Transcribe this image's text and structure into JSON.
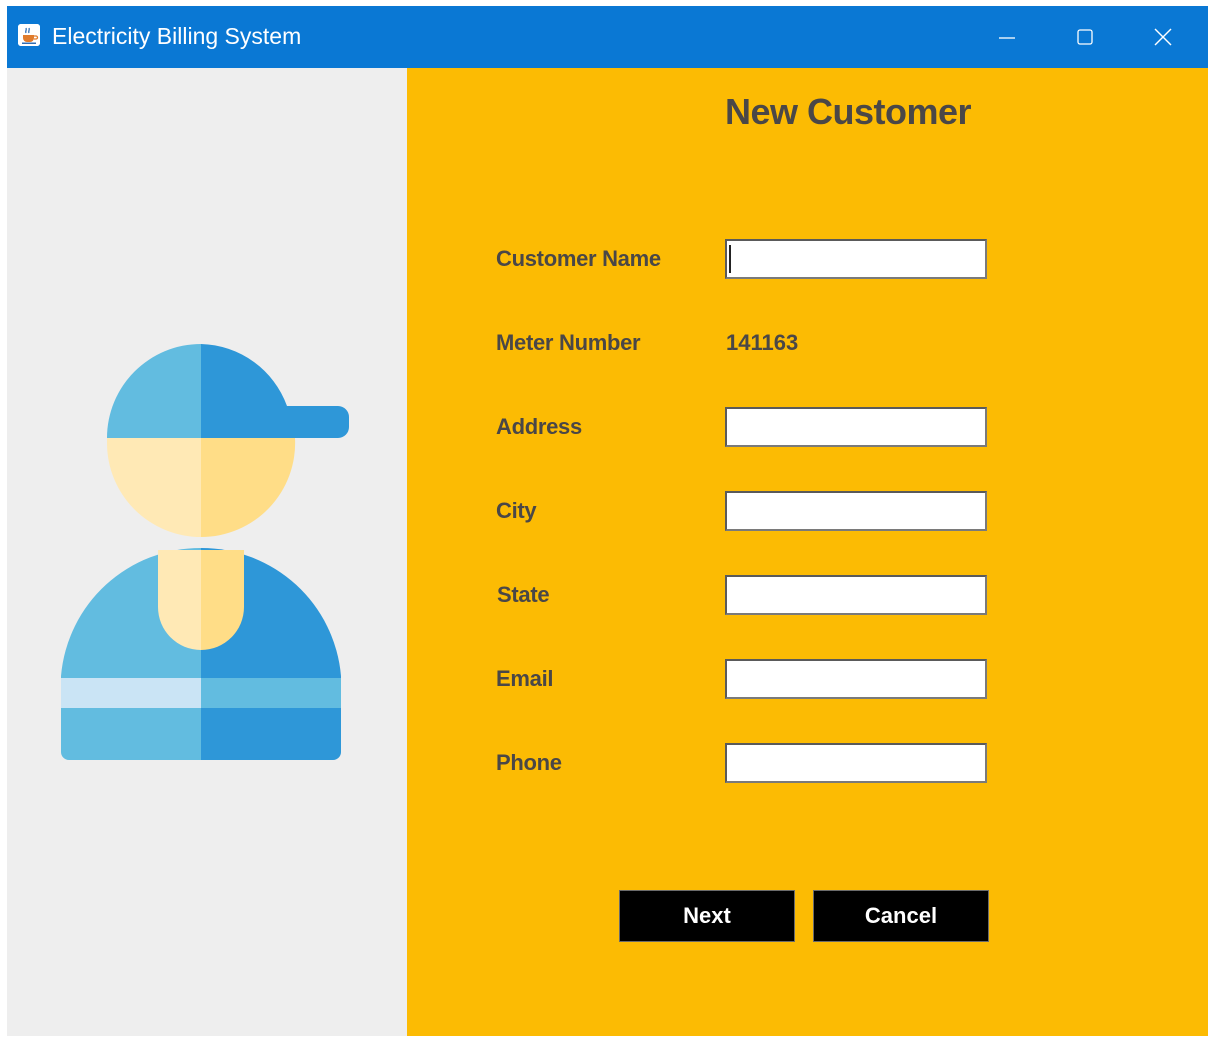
{
  "window": {
    "title": "Electricity Billing System",
    "app_icon": "java-cup-icon",
    "controls": [
      "minimize-icon",
      "maximize-icon",
      "close-icon"
    ]
  },
  "illustration": {
    "icon": "worker-with-cap-icon",
    "colors": {
      "cap_light": "#62bce0",
      "cap_dark": "#2e97d8",
      "skin_light": "#ffe9b5",
      "skin_dark": "#ffdd87",
      "stripe_light": "#cae4f5"
    }
  },
  "form": {
    "heading": "New Customer",
    "fields": {
      "customer_name": {
        "label": "Customer Name",
        "value": ""
      },
      "meter_number": {
        "label": "Meter Number",
        "value": "141163"
      },
      "address": {
        "label": "Address",
        "value": ""
      },
      "city": {
        "label": "City",
        "value": ""
      },
      "state": {
        "label": "State",
        "value": ""
      },
      "email": {
        "label": "Email",
        "value": ""
      },
      "phone": {
        "label": "Phone",
        "value": ""
      }
    },
    "buttons": {
      "next": "Next",
      "cancel": "Cancel"
    }
  },
  "colors": {
    "titlebar": "#0a78d4",
    "form_background": "#fcbb03",
    "left_background": "#eeeeee",
    "label_text": "#4a4747",
    "button_background": "#000000",
    "button_text": "#ffffff"
  }
}
